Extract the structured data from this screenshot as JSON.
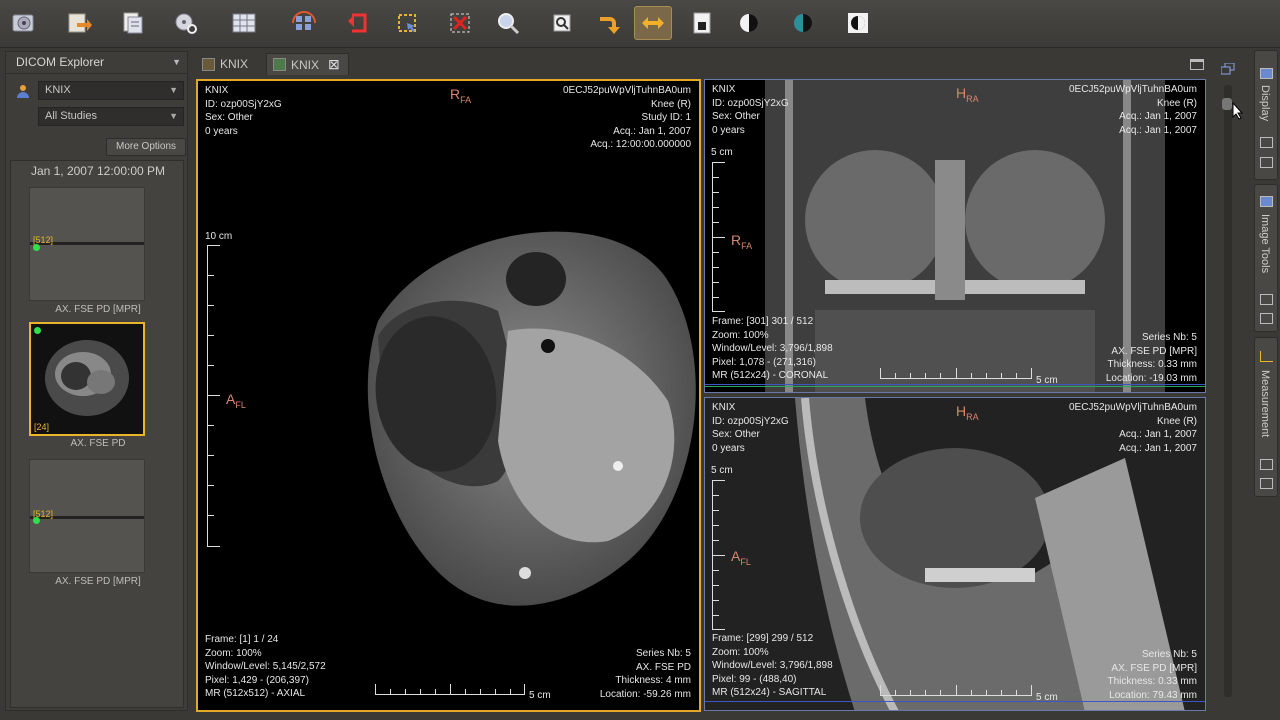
{
  "toolbar": {
    "buttons": [
      {
        "name": "open-folder",
        "icon": "folder-cd-icon"
      },
      {
        "name": "open-dicomdir",
        "icon": "folder-arrow-icon"
      },
      {
        "name": "open-file",
        "icon": "file-icon"
      },
      {
        "name": "search-pacs",
        "icon": "disk-search-icon"
      },
      {
        "name": "layout-grid",
        "icon": "grid-icon"
      },
      {
        "name": "synchronize",
        "icon": "sync-icon"
      },
      {
        "name": "reset",
        "icon": "reset-icon"
      },
      {
        "name": "select-region",
        "icon": "select-icon"
      },
      {
        "name": "delete",
        "icon": "delete-icon"
      },
      {
        "name": "zoom",
        "icon": "zoom-icon"
      },
      {
        "name": "pan",
        "icon": "pan-icon"
      },
      {
        "name": "rotate",
        "icon": "rotate-icon"
      },
      {
        "name": "flip",
        "icon": "flip-icon"
      },
      {
        "name": "window-level",
        "icon": "window-level-icon"
      },
      {
        "name": "invert-lut",
        "icon": "invert-icon"
      },
      {
        "name": "color-lut",
        "icon": "color-lut-icon"
      },
      {
        "name": "filter",
        "icon": "filter-icon"
      }
    ]
  },
  "explorer": {
    "title": "DICOM Explorer",
    "patient": "KNIX",
    "studies": "All Studies",
    "more_options": "More Options",
    "study_date": "Jan 1, 2007 12:00:00 PM",
    "series": [
      {
        "number": "[512]",
        "label": "AX.  FSE PD [MPR]"
      },
      {
        "number": "[24]",
        "label": "AX.  FSE PD"
      },
      {
        "number": "[512]",
        "label": "AX.  FSE PD [MPR]"
      }
    ]
  },
  "tabs": [
    {
      "label": "KNIX"
    },
    {
      "label": "KNIX"
    }
  ],
  "views": {
    "axial": {
      "top_left": [
        "KNIX",
        "ID: ozp00SjY2xG",
        "Sex: Other",
        "0 years"
      ],
      "top_right": [
        "0ECJ52puWpVljTuhnBA0um",
        "Knee (R)",
        "Study ID: 1",
        "Acq.: Jan 1, 2007",
        "Acq.: 12:00:00.000000"
      ],
      "bottom_left": [
        "Frame: [1] 1 / 24",
        "Zoom: 100%",
        "Window/Level: 5,145/2,572",
        "Pixel: 1,429 - (206,397)",
        "MR (512x512) - AXIAL"
      ],
      "bottom_right": [
        "Series Nb: 5",
        "AX.  FSE PD",
        "Thickness: 4 mm",
        "Location: -59.26 mm"
      ],
      "orient_top": "R",
      "orient_top_sub": "FA",
      "orient_left": "A",
      "orient_left_sub": "FL",
      "ruler_v_label": "10 cm",
      "ruler_h_label": "5 cm"
    },
    "coronal": {
      "top_left": [
        "KNIX",
        "ID: ozp00SjY2xG",
        "Sex: Other",
        "0 years"
      ],
      "top_right": [
        "0ECJ52puWpVljTuhnBA0um",
        "Knee (R)",
        "Acq.: Jan 1, 2007",
        "Acq.: Jan 1, 2007"
      ],
      "bottom_left": [
        "Frame: [301] 301 / 512",
        "Zoom: 100%",
        "Window/Level: 3,796/1,898",
        "Pixel: 1,078 - (271,316)",
        "MR (512x24) - CORONAL"
      ],
      "bottom_right": [
        "Series Nb: 5",
        "AX.  FSE PD [MPR]",
        "Thickness: 0.33 mm",
        "Location: -19.03 mm"
      ],
      "orient_top": "H",
      "orient_top_sub": "RA",
      "orient_left": "R",
      "orient_left_sub": "FA",
      "ruler_v_label": "5 cm",
      "ruler_h_label": "5 cm"
    },
    "sagittal": {
      "top_left": [
        "KNIX",
        "ID: ozp00SjY2xG",
        "Sex: Other",
        "0 years"
      ],
      "top_right": [
        "0ECJ52puWpVljTuhnBA0um",
        "Knee (R)",
        "Acq.: Jan 1, 2007",
        "Acq.: Jan 1, 2007"
      ],
      "bottom_left": [
        "Frame: [299] 299 / 512",
        "Zoom: 100%",
        "Window/Level: 3,796/1,898",
        "Pixel: 99 - (488,40)",
        "MR (512x24) - SAGITTAL"
      ],
      "bottom_right": [
        "Series Nb: 5",
        "AX.  FSE PD [MPR]",
        "Thickness: 0.33 mm",
        "Location: 79.43 mm"
      ],
      "orient_top": "H",
      "orient_top_sub": "RA",
      "orient_left": "A",
      "orient_left_sub": "FL",
      "ruler_v_label": "5 cm",
      "ruler_h_label": "5 cm"
    }
  },
  "side_panels": [
    {
      "label": "Display"
    },
    {
      "label": "Image Tools"
    },
    {
      "label": "Measurement"
    }
  ],
  "colors": {
    "selected_border": "#e3a826",
    "orientation_text": "#d9866f",
    "overlay_text": "#e7e7e7",
    "thumb_dot": "#2fe04a"
  }
}
